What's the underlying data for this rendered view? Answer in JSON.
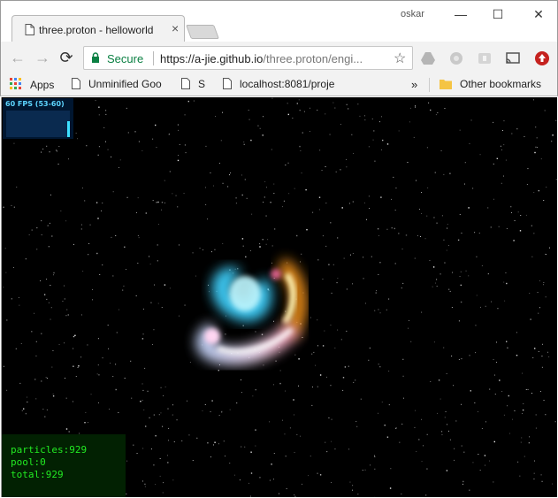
{
  "window": {
    "user": "oskar",
    "minimize_glyph": "—",
    "maximize_glyph": "☐",
    "close_glyph": "✕"
  },
  "tab": {
    "title": "three.proton - helloworld",
    "close_glyph": "×"
  },
  "toolbar": {
    "back_glyph": "←",
    "forward_glyph": "→",
    "reload_glyph": "⟳",
    "secure_label": "Secure",
    "url_host": "https://a-jie.github.io",
    "url_rest": "/three.proton/engi...",
    "bookmark_star": "☆"
  },
  "bookmarks": {
    "apps": "Apps",
    "items": [
      "Unminified Goo",
      "S",
      "localhost:8081/proje"
    ],
    "overflow": "»",
    "other": "Other bookmarks"
  },
  "canvas": {
    "fps_label": "60 FPS (53-60)",
    "stats": {
      "particles": "particles:929",
      "pool": "pool:0",
      "total": "total:929"
    }
  },
  "colors": {
    "secure_green": "#0b8043",
    "fps_text": "#5dd5ff",
    "stats_text": "#22ea22",
    "stats_bg": "#022102"
  }
}
